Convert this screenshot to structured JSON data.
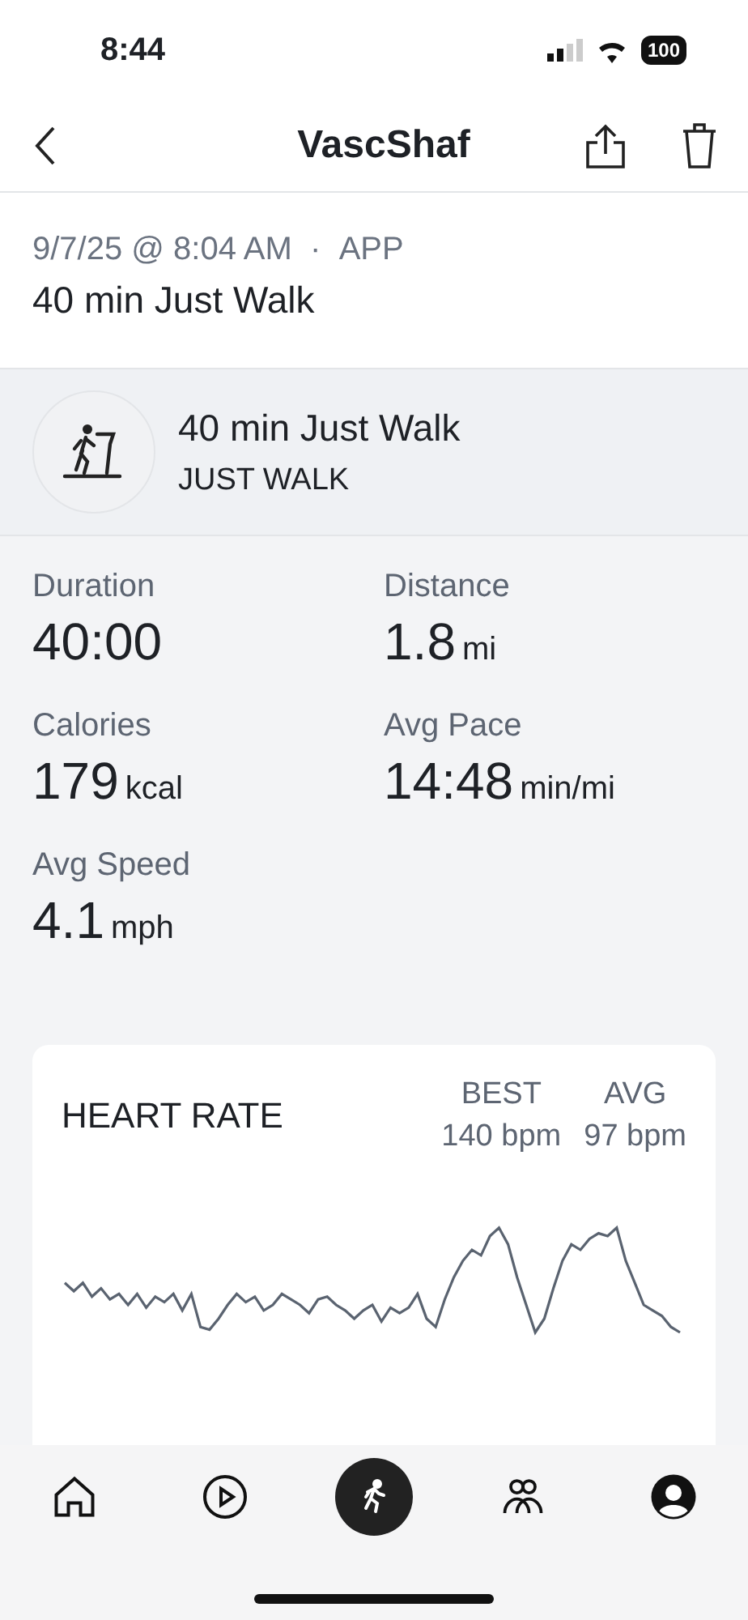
{
  "status_bar": {
    "time": "8:44",
    "battery": "100"
  },
  "nav": {
    "title": "VascShaf"
  },
  "header": {
    "date": "9/7/25 @ 8:04 AM",
    "separator": "·",
    "source": "APP",
    "title": "40 min Just Walk"
  },
  "activity": {
    "title": "40 min Just Walk",
    "type": "JUST WALK"
  },
  "stats": [
    {
      "label": "Duration",
      "value": "40:00"
    },
    {
      "label": "Distance",
      "value": "1.8",
      "unit": "mi"
    },
    {
      "label": "Calories",
      "value": "179",
      "unit": "kcal"
    },
    {
      "label": "Avg Pace",
      "value": "14:48",
      "unit": "min/mi"
    },
    {
      "label": "Avg Speed",
      "value": "4.1",
      "unit": "mph"
    }
  ],
  "heart_rate": {
    "title": "HEART RATE",
    "summaries": [
      {
        "label": "BEST",
        "value": "140 bpm"
      },
      {
        "label": "AVG",
        "value": "97 bpm"
      }
    ]
  },
  "tab_bar": [
    {
      "kind": "home",
      "selected": false
    },
    {
      "kind": "play",
      "selected": false
    },
    {
      "kind": "workout",
      "selected": true
    },
    {
      "kind": "community",
      "selected": false
    },
    {
      "kind": "profile",
      "selected": false
    }
  ]
}
